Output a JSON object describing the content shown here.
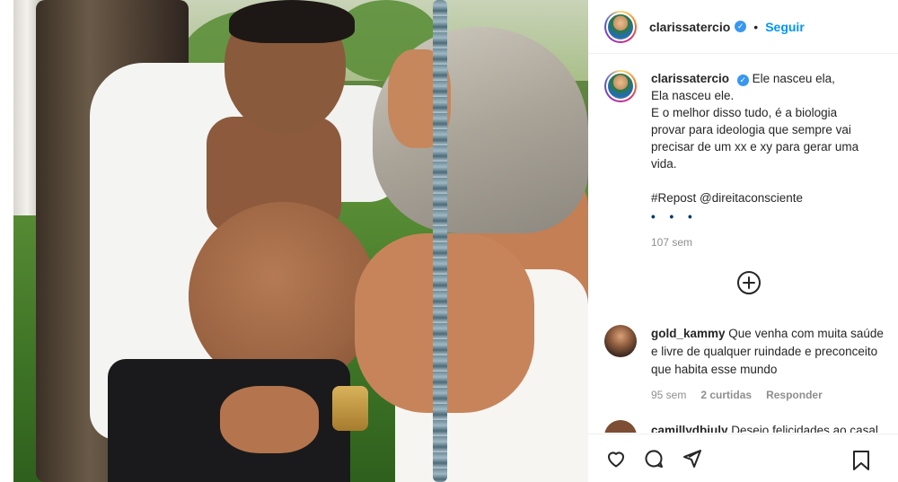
{
  "post": {
    "username": "clarissatercio",
    "follow_label": "Seguir",
    "dot": "•",
    "caption_lines": [
      "Ele nasceu ela,",
      "Ela nasceu ele.",
      "E o melhor disso tudo, é a biologia",
      "provar para ideologia que sempre vai",
      "precisar de um xx e xy para gerar uma",
      "vida."
    ],
    "hashtags": "#Repost @direitaconsciente",
    "more": "• • •",
    "time": "107 sem",
    "verified_mark": "✓"
  },
  "comments": [
    {
      "username": "gold_kammy",
      "text": "Que venha com muita saúde e livre de qualquer ruindade e preconceito que habita esse mundo",
      "time": "95 sem",
      "likes": "2 curtidas",
      "reply": "Responder"
    },
    {
      "username": "camillydbiuly",
      "text": "Desejo felicidades ao casal"
    }
  ],
  "icons": {
    "plus": "load-more-comments-icon",
    "like": "heart-icon",
    "comment": "comment-icon",
    "share": "share-icon",
    "save": "bookmark-icon"
  }
}
